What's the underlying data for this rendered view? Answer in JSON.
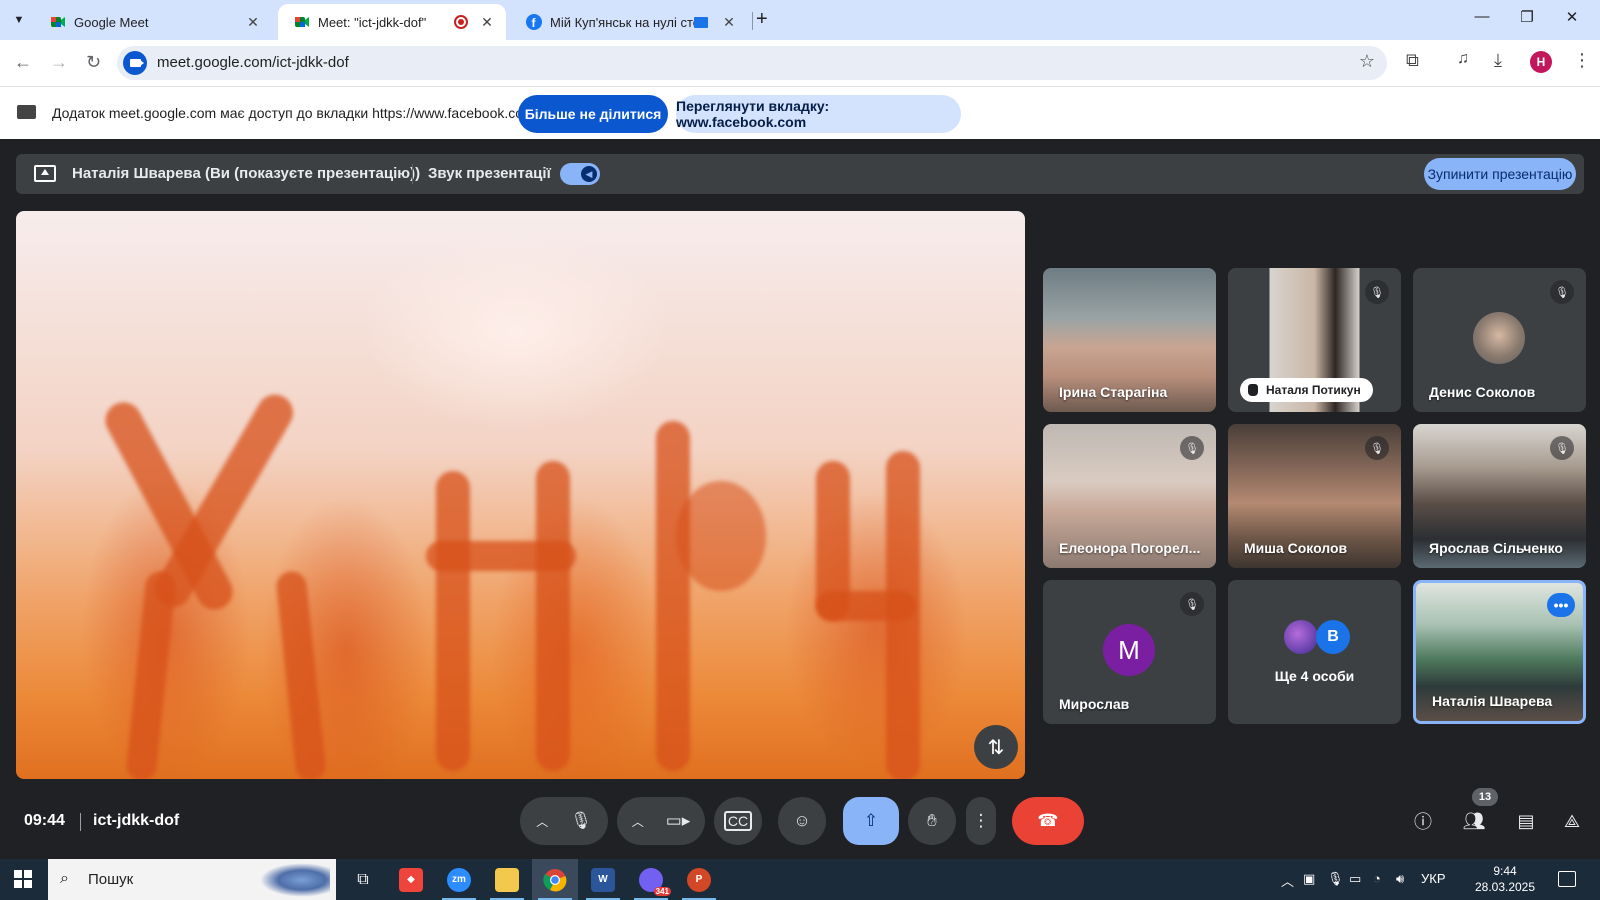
{
  "browser": {
    "tabs": [
      {
        "title": "Google Meet",
        "active": false
      },
      {
        "title": "Meet: \"ict-jdkk-dof\"",
        "active": true
      },
      {
        "title": "Мій Куп'янськ на нулі стоїть",
        "active": false
      }
    ],
    "url": "meet.google.com/ict-jdkk-dof",
    "profile_initial": "Н"
  },
  "infobar": {
    "message": "Додаток meet.google.com має доступ до вкладки https://www.facebook.com",
    "stop_sharing_label": "Більше не ділитися",
    "view_tab_label": "Переглянути вкладку: www.facebook.com"
  },
  "presentation_bar": {
    "presenter": "Наталія Шварева (Ви (показуєте презентацію))",
    "audio_label": "Звук презентації",
    "audio_on": true,
    "stop_label": "Зупинити презентацію"
  },
  "participants": [
    {
      "name": "Ірина Старагіна",
      "muted": false,
      "video": true
    },
    {
      "name": "Наталя Потикун",
      "muted": true,
      "video": true,
      "hand_raised": true
    },
    {
      "name": "Денис Соколов",
      "muted": true,
      "video": false
    },
    {
      "name": "Елеонора Погорел...",
      "muted": true,
      "video": true
    },
    {
      "name": "Миша Соколов",
      "muted": true,
      "video": true
    },
    {
      "name": "Ярослав Сільченко",
      "muted": true,
      "video": true
    },
    {
      "name": "Мирослав",
      "muted": true,
      "video": false,
      "initial": "М"
    },
    {
      "name": "Наталія Шварева",
      "muted": false,
      "video": true,
      "self": true
    }
  ],
  "more_people": {
    "label": "Ще 4 особи",
    "avatar_letter": "В"
  },
  "meeting": {
    "time": "09:44",
    "code": "ict-jdkk-dof",
    "people_count": "13"
  },
  "taskbar": {
    "search_placeholder": "Пошук",
    "zoom_label": "zm",
    "viber_badge": "341",
    "language": "УКР",
    "time": "9:44",
    "date": "28.03.2025"
  },
  "colors": {
    "meet_bg": "#202124",
    "accent_blue": "#8ab4f8",
    "end_call_red": "#ea4335",
    "chrome_tabstrip": "#d3e3fd"
  }
}
